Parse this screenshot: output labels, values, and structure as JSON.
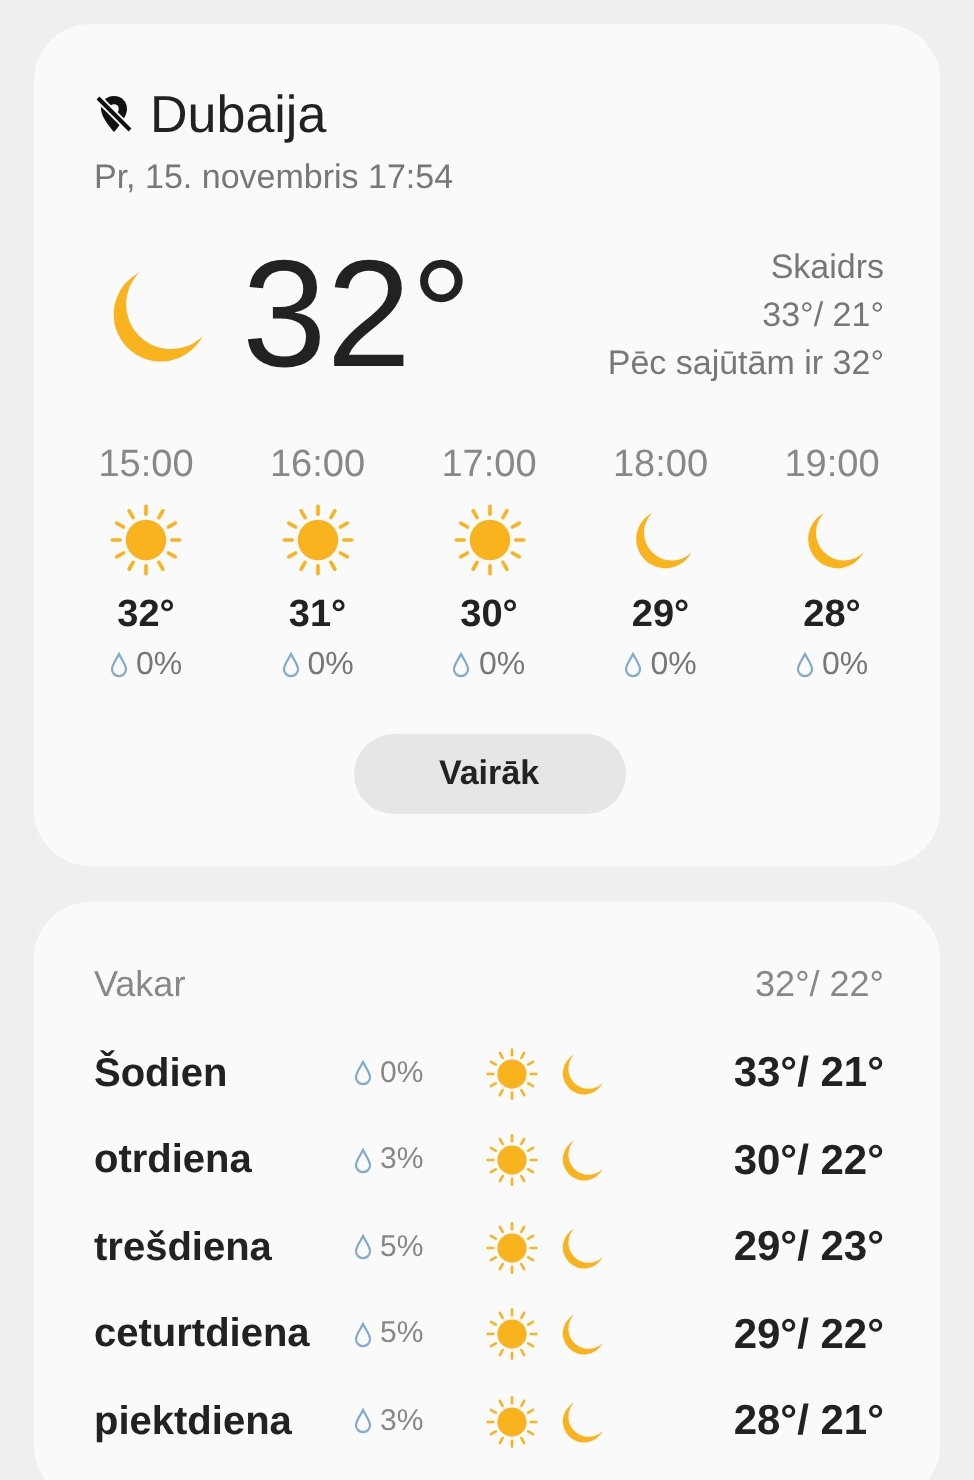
{
  "location": {
    "name": "Dubaija",
    "date": "Pr, 15. novembris 17:54"
  },
  "current": {
    "kind": "moon",
    "temp": "32°",
    "condition": "Skaidrs",
    "high_low": "33°/ 21°",
    "feels_like": "Pēc sajūtām ir 32°"
  },
  "hourly": [
    {
      "time": "15:00",
      "kind": "sun",
      "temp": "32°",
      "precip": "0%"
    },
    {
      "time": "16:00",
      "kind": "sun",
      "temp": "31°",
      "precip": "0%"
    },
    {
      "time": "17:00",
      "kind": "sun",
      "temp": "30°",
      "precip": "0%"
    },
    {
      "time": "18:00",
      "kind": "moon",
      "temp": "29°",
      "precip": "0%"
    },
    {
      "time": "19:00",
      "kind": "moon",
      "temp": "28°",
      "precip": "0%"
    }
  ],
  "more_button": "Vairāk",
  "yesterday": {
    "label": "Vakar",
    "temps": "32°/ 22°"
  },
  "days": [
    {
      "day": "Šodien",
      "precip": "0%",
      "kind": "clear",
      "temps": "33°/ 21°"
    },
    {
      "day": "otrdiena",
      "precip": "3%",
      "kind": "clear",
      "temps": "30°/ 22°"
    },
    {
      "day": "trešdiena",
      "precip": "5%",
      "kind": "clear",
      "temps": "29°/ 23°"
    },
    {
      "day": "ceturtdiena",
      "precip": "5%",
      "kind": "clear",
      "temps": "29°/ 22°"
    },
    {
      "day": "piektdiena",
      "precip": "3%",
      "kind": "clear",
      "temps": "28°/ 21°"
    }
  ]
}
